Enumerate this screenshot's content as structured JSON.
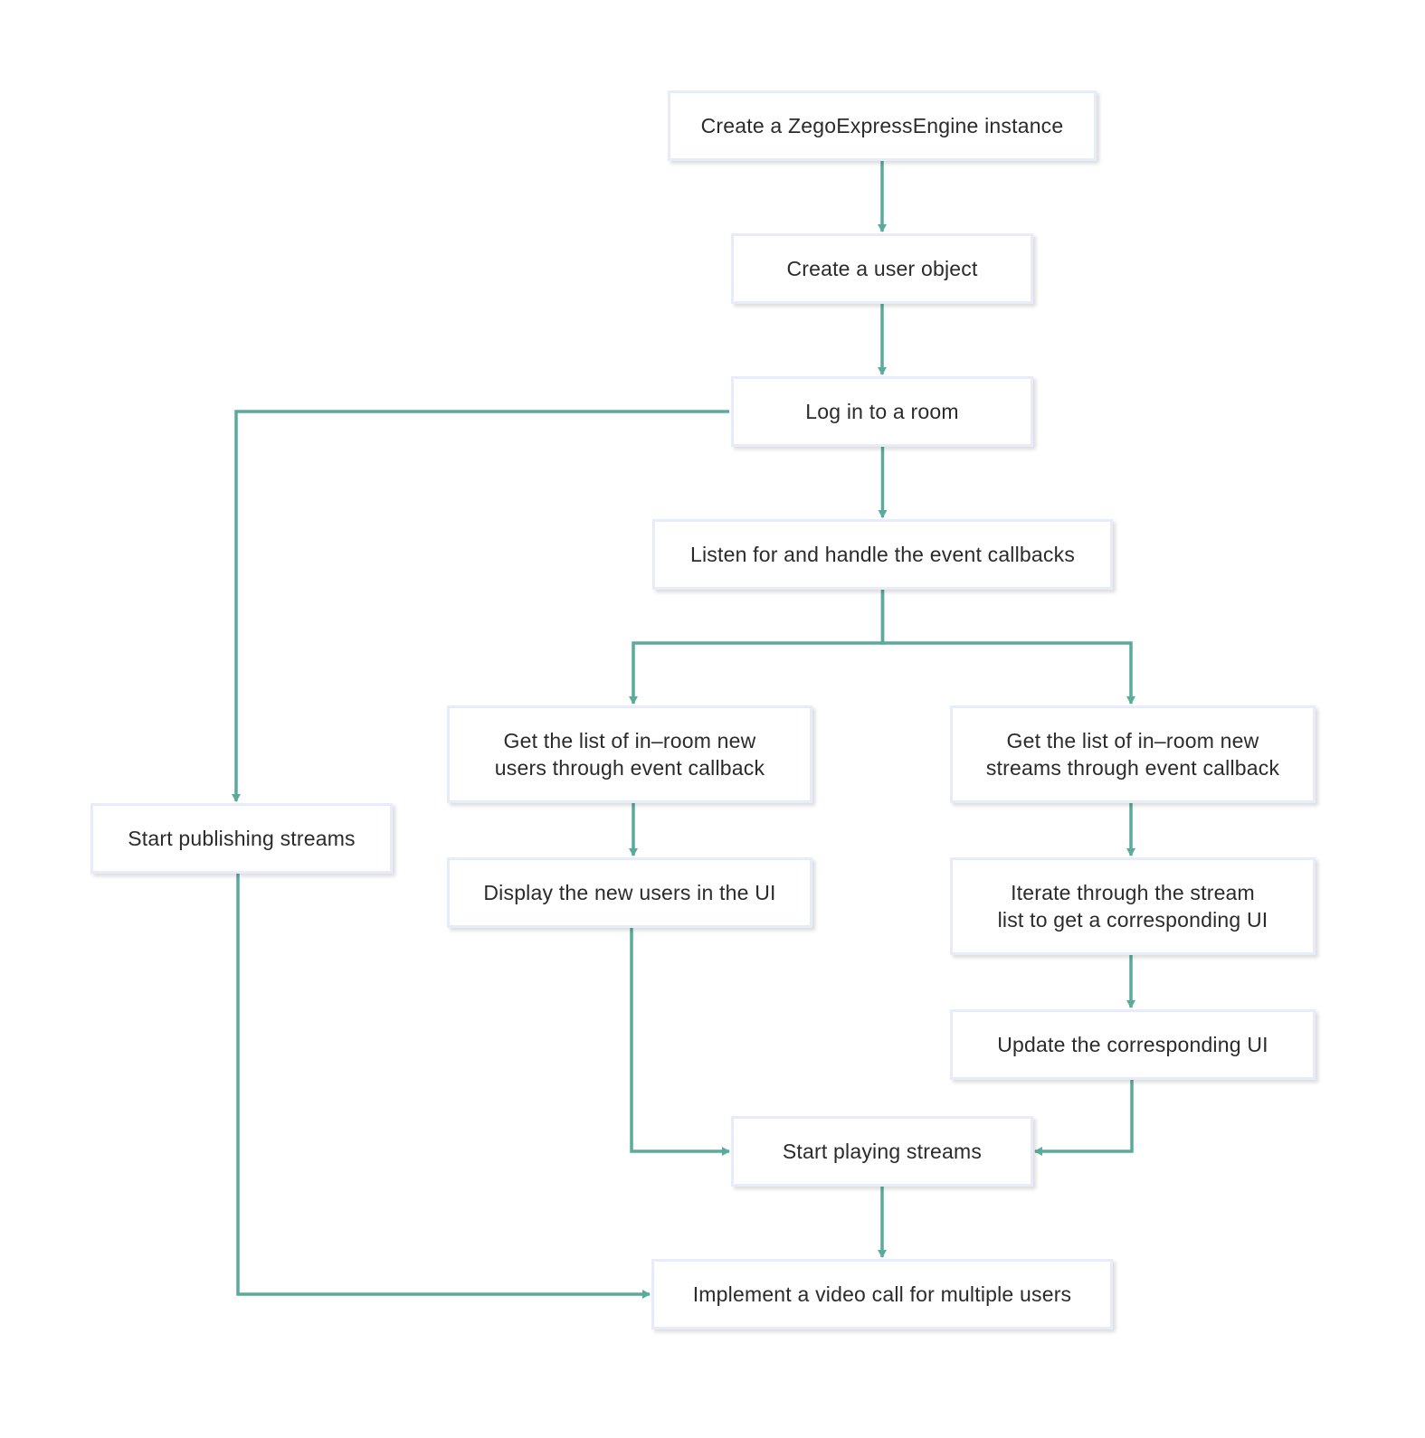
{
  "diagram": {
    "type": "flowchart",
    "colors": {
      "edge": "#5aab9c",
      "node_border": "#e6ecf9",
      "text": "#2b2b2b"
    },
    "nodes": {
      "create_engine": {
        "label": "Create a ZegoExpressEngine instance"
      },
      "create_user": {
        "label": "Create a user object"
      },
      "login_room": {
        "label": "Log in to a room"
      },
      "listen_callbacks": {
        "label": "Listen for and handle the event callbacks"
      },
      "get_new_users": {
        "label": "Get the list of in–room new\nusers through event callback"
      },
      "get_new_streams": {
        "label": "Get the list of in–room new\nstreams through event callback"
      },
      "start_publishing": {
        "label": "Start publishing streams"
      },
      "display_new_users": {
        "label": "Display the new users in the UI"
      },
      "iterate_stream_list": {
        "label": "Iterate through the stream\nlist to get a corresponding UI"
      },
      "update_ui": {
        "label": "Update the corresponding UI"
      },
      "start_playing": {
        "label": "Start playing streams"
      },
      "implement_video_call": {
        "label": "Implement a video call for multiple users"
      }
    },
    "edges": [
      {
        "from": "create_engine",
        "to": "create_user"
      },
      {
        "from": "create_user",
        "to": "login_room"
      },
      {
        "from": "login_room",
        "to": "listen_callbacks"
      },
      {
        "from": "login_room",
        "to": "start_publishing"
      },
      {
        "from": "listen_callbacks",
        "to": "get_new_users"
      },
      {
        "from": "listen_callbacks",
        "to": "get_new_streams"
      },
      {
        "from": "get_new_users",
        "to": "display_new_users"
      },
      {
        "from": "get_new_streams",
        "to": "iterate_stream_list"
      },
      {
        "from": "iterate_stream_list",
        "to": "update_ui"
      },
      {
        "from": "display_new_users",
        "to": "start_playing"
      },
      {
        "from": "update_ui",
        "to": "start_playing"
      },
      {
        "from": "start_playing",
        "to": "implement_video_call"
      },
      {
        "from": "start_publishing",
        "to": "implement_video_call"
      }
    ]
  }
}
